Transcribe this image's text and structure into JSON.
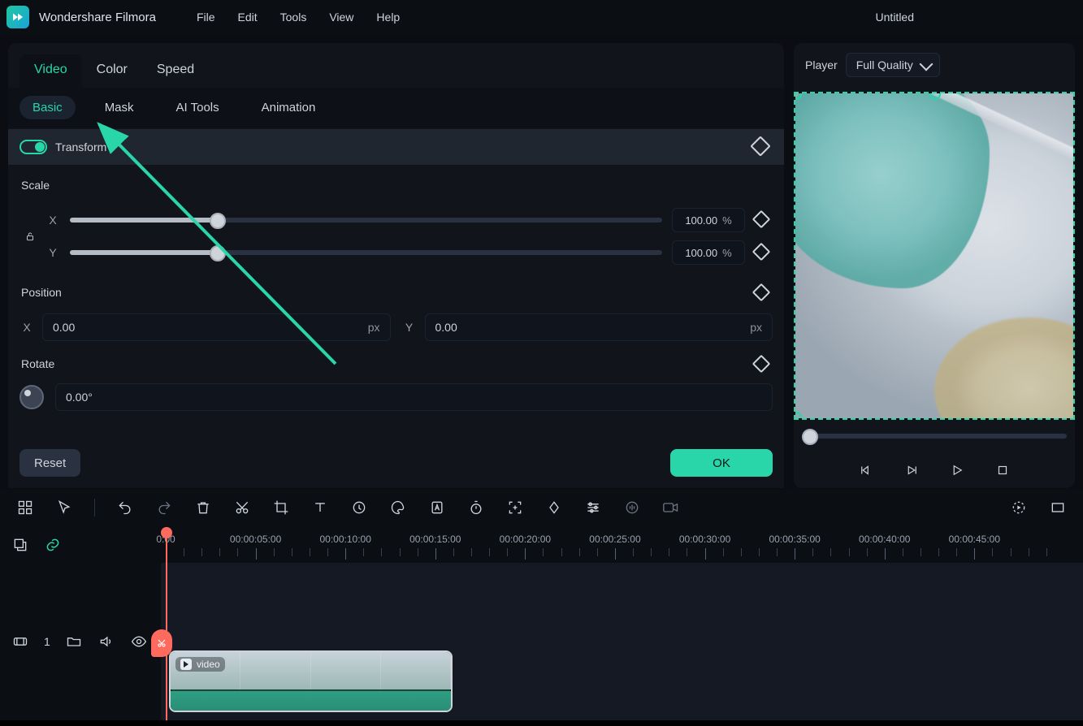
{
  "app": {
    "name": "Wondershare Filmora"
  },
  "menu": {
    "file": "File",
    "edit": "Edit",
    "tools": "Tools",
    "view": "View",
    "help": "Help"
  },
  "doc": {
    "title": "Untitled"
  },
  "tabs": {
    "video": "Video",
    "color": "Color",
    "speed": "Speed"
  },
  "subtabs": {
    "basic": "Basic",
    "mask": "Mask",
    "ai": "AI Tools",
    "anim": "Animation"
  },
  "transform": {
    "title": "Transform"
  },
  "scale": {
    "title": "Scale",
    "x_label": "X",
    "y_label": "Y",
    "x_value": "100.00",
    "y_value": "100.00",
    "unit": "%",
    "x_pct": 25,
    "y_pct": 25
  },
  "position": {
    "title": "Position",
    "x_label": "X",
    "y_label": "Y",
    "x_value": "0.00",
    "y_value": "0.00",
    "unit": "px"
  },
  "rotate": {
    "title": "Rotate",
    "value": "0.00°"
  },
  "buttons": {
    "reset": "Reset",
    "ok": "OK"
  },
  "player": {
    "label": "Player",
    "quality": "Full Quality"
  },
  "ruler": {
    "labels": [
      "0:00",
      "00:00:05:00",
      "00:00:10:00",
      "00:00:15:00",
      "00:00:20:00",
      "00:00:25:00",
      "00:00:30:00",
      "00:00:35:00",
      "00:00:40:00",
      "00:00:45:00"
    ]
  },
  "track": {
    "index": "1"
  },
  "clip": {
    "name": "video"
  }
}
